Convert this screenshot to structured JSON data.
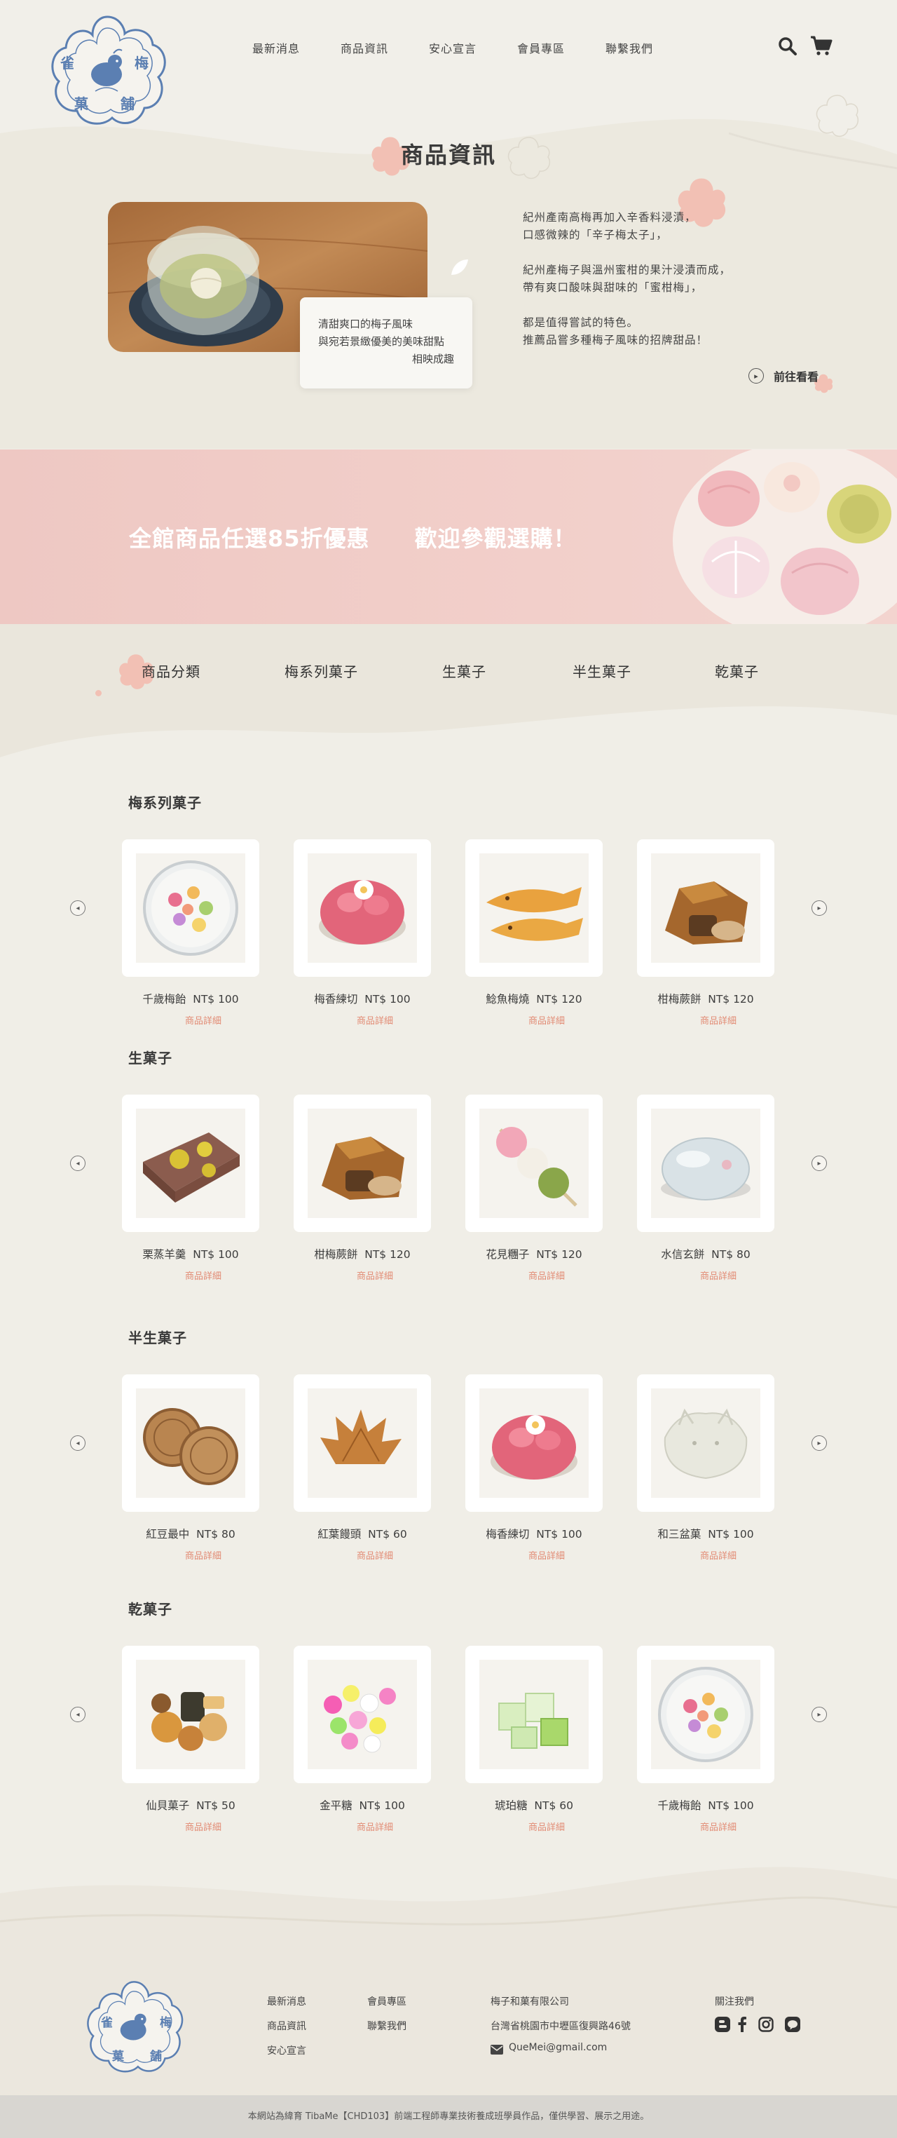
{
  "brand": {
    "logo_chars": [
      "雀",
      "梅",
      "菓",
      "舗"
    ]
  },
  "nav": {
    "items": [
      "最新消息",
      "商品資訊",
      "安心宣言",
      "會員專區",
      "聯繫我們"
    ]
  },
  "intro": {
    "title": "商品資訊",
    "card_lines": [
      "清甜爽口的梅子風味",
      "與宛若景緻優美的美味甜點",
      "相映成趣"
    ],
    "text_lines": [
      "紀州產南高梅再加入辛香料浸漬，",
      "口感微辣的「辛子梅太子」，",
      "",
      "紀州產梅子與溫州蜜柑的果汁浸漬而成，",
      "帶有爽口酸味與甜味的「蜜柑梅」，",
      "",
      "都是值得嘗試的特色。",
      "推薦品嘗多種梅子風味的招牌甜品！"
    ],
    "more_label": "前往看看"
  },
  "banner": {
    "text_1": "全館商品任選85折優惠",
    "text_2": "歡迎參觀選購！"
  },
  "categories": {
    "items": [
      "商品分類",
      "梅系列菓子",
      "生菓子",
      "半生菓子",
      "乾菓子"
    ]
  },
  "sections": [
    {
      "heading": "梅系列菓子",
      "products": [
        {
          "name": "千歲梅飴",
          "price": "NT$ 100",
          "detail": "商品詳細",
          "icon": "candy-jar"
        },
        {
          "name": "梅香練切",
          "price": "NT$ 100",
          "detail": "商品詳細",
          "icon": "pink-nerikiri"
        },
        {
          "name": "鯰魚梅燒",
          "price": "NT$ 120",
          "detail": "商品詳細",
          "icon": "fish-cake"
        },
        {
          "name": "柑梅蕨餅",
          "price": "NT$ 120",
          "detail": "商品詳細",
          "icon": "warabi-mochi"
        }
      ]
    },
    {
      "heading": "生菓子",
      "products": [
        {
          "name": "栗蒸羊羹",
          "price": "NT$ 100",
          "detail": "商品詳細",
          "icon": "yokan"
        },
        {
          "name": "柑梅蕨餅",
          "price": "NT$ 120",
          "detail": "商品詳細",
          "icon": "warabi-mochi"
        },
        {
          "name": "花見糰子",
          "price": "NT$ 120",
          "detail": "商品詳細",
          "icon": "dango"
        },
        {
          "name": "水信玄餅",
          "price": "NT$ 80",
          "detail": "商品詳細",
          "icon": "raindrop-cake"
        }
      ]
    },
    {
      "heading": "半生菓子",
      "products": [
        {
          "name": "紅豆最中",
          "price": "NT$ 80",
          "detail": "商品詳細",
          "icon": "monaka"
        },
        {
          "name": "紅葉饅頭",
          "price": "NT$ 60",
          "detail": "商品詳細",
          "icon": "momiji-manju"
        },
        {
          "name": "梅香練切",
          "price": "NT$ 100",
          "detail": "商品詳細",
          "icon": "pink-nerikiri"
        },
        {
          "name": "和三盆菓",
          "price": "NT$ 100",
          "detail": "商品詳細",
          "icon": "wasanbon"
        }
      ]
    },
    {
      "heading": "乾菓子",
      "products": [
        {
          "name": "仙貝菓子",
          "price": "NT$ 50",
          "detail": "商品詳細",
          "icon": "senbei"
        },
        {
          "name": "金平糖",
          "price": "NT$ 100",
          "detail": "商品詳細",
          "icon": "konpeito"
        },
        {
          "name": "琥珀糖",
          "price": "NT$ 60",
          "detail": "商品詳細",
          "icon": "kohakuto"
        },
        {
          "name": "千歲梅飴",
          "price": "NT$ 100",
          "detail": "商品詳細",
          "icon": "candy-jar"
        }
      ]
    }
  ],
  "footer": {
    "links_col1": [
      "最新消息",
      "商品資訊",
      "安心宣言"
    ],
    "links_col2": [
      "會員專區",
      "聯繫我們"
    ],
    "company": "梅子和菓有限公司",
    "address": "台灣省桃園市中壢區復興路46號",
    "email": "QueMei@gmail.com",
    "follow_label": "關注我們",
    "social_icons": [
      "blogger-icon",
      "facebook-icon",
      "instagram-icon",
      "line-icon"
    ],
    "copyright": "本網站為緯育 TibaMe【CHD103】前端工程師專業技術養成班學員作品，僅供學習、展示之用途。"
  },
  "colors": {
    "logo_blue": "#5b7fb2",
    "accent_pink": "#f2c0b4",
    "detail_text": "#e28b74",
    "banner_pink": "#f0cbc6"
  }
}
